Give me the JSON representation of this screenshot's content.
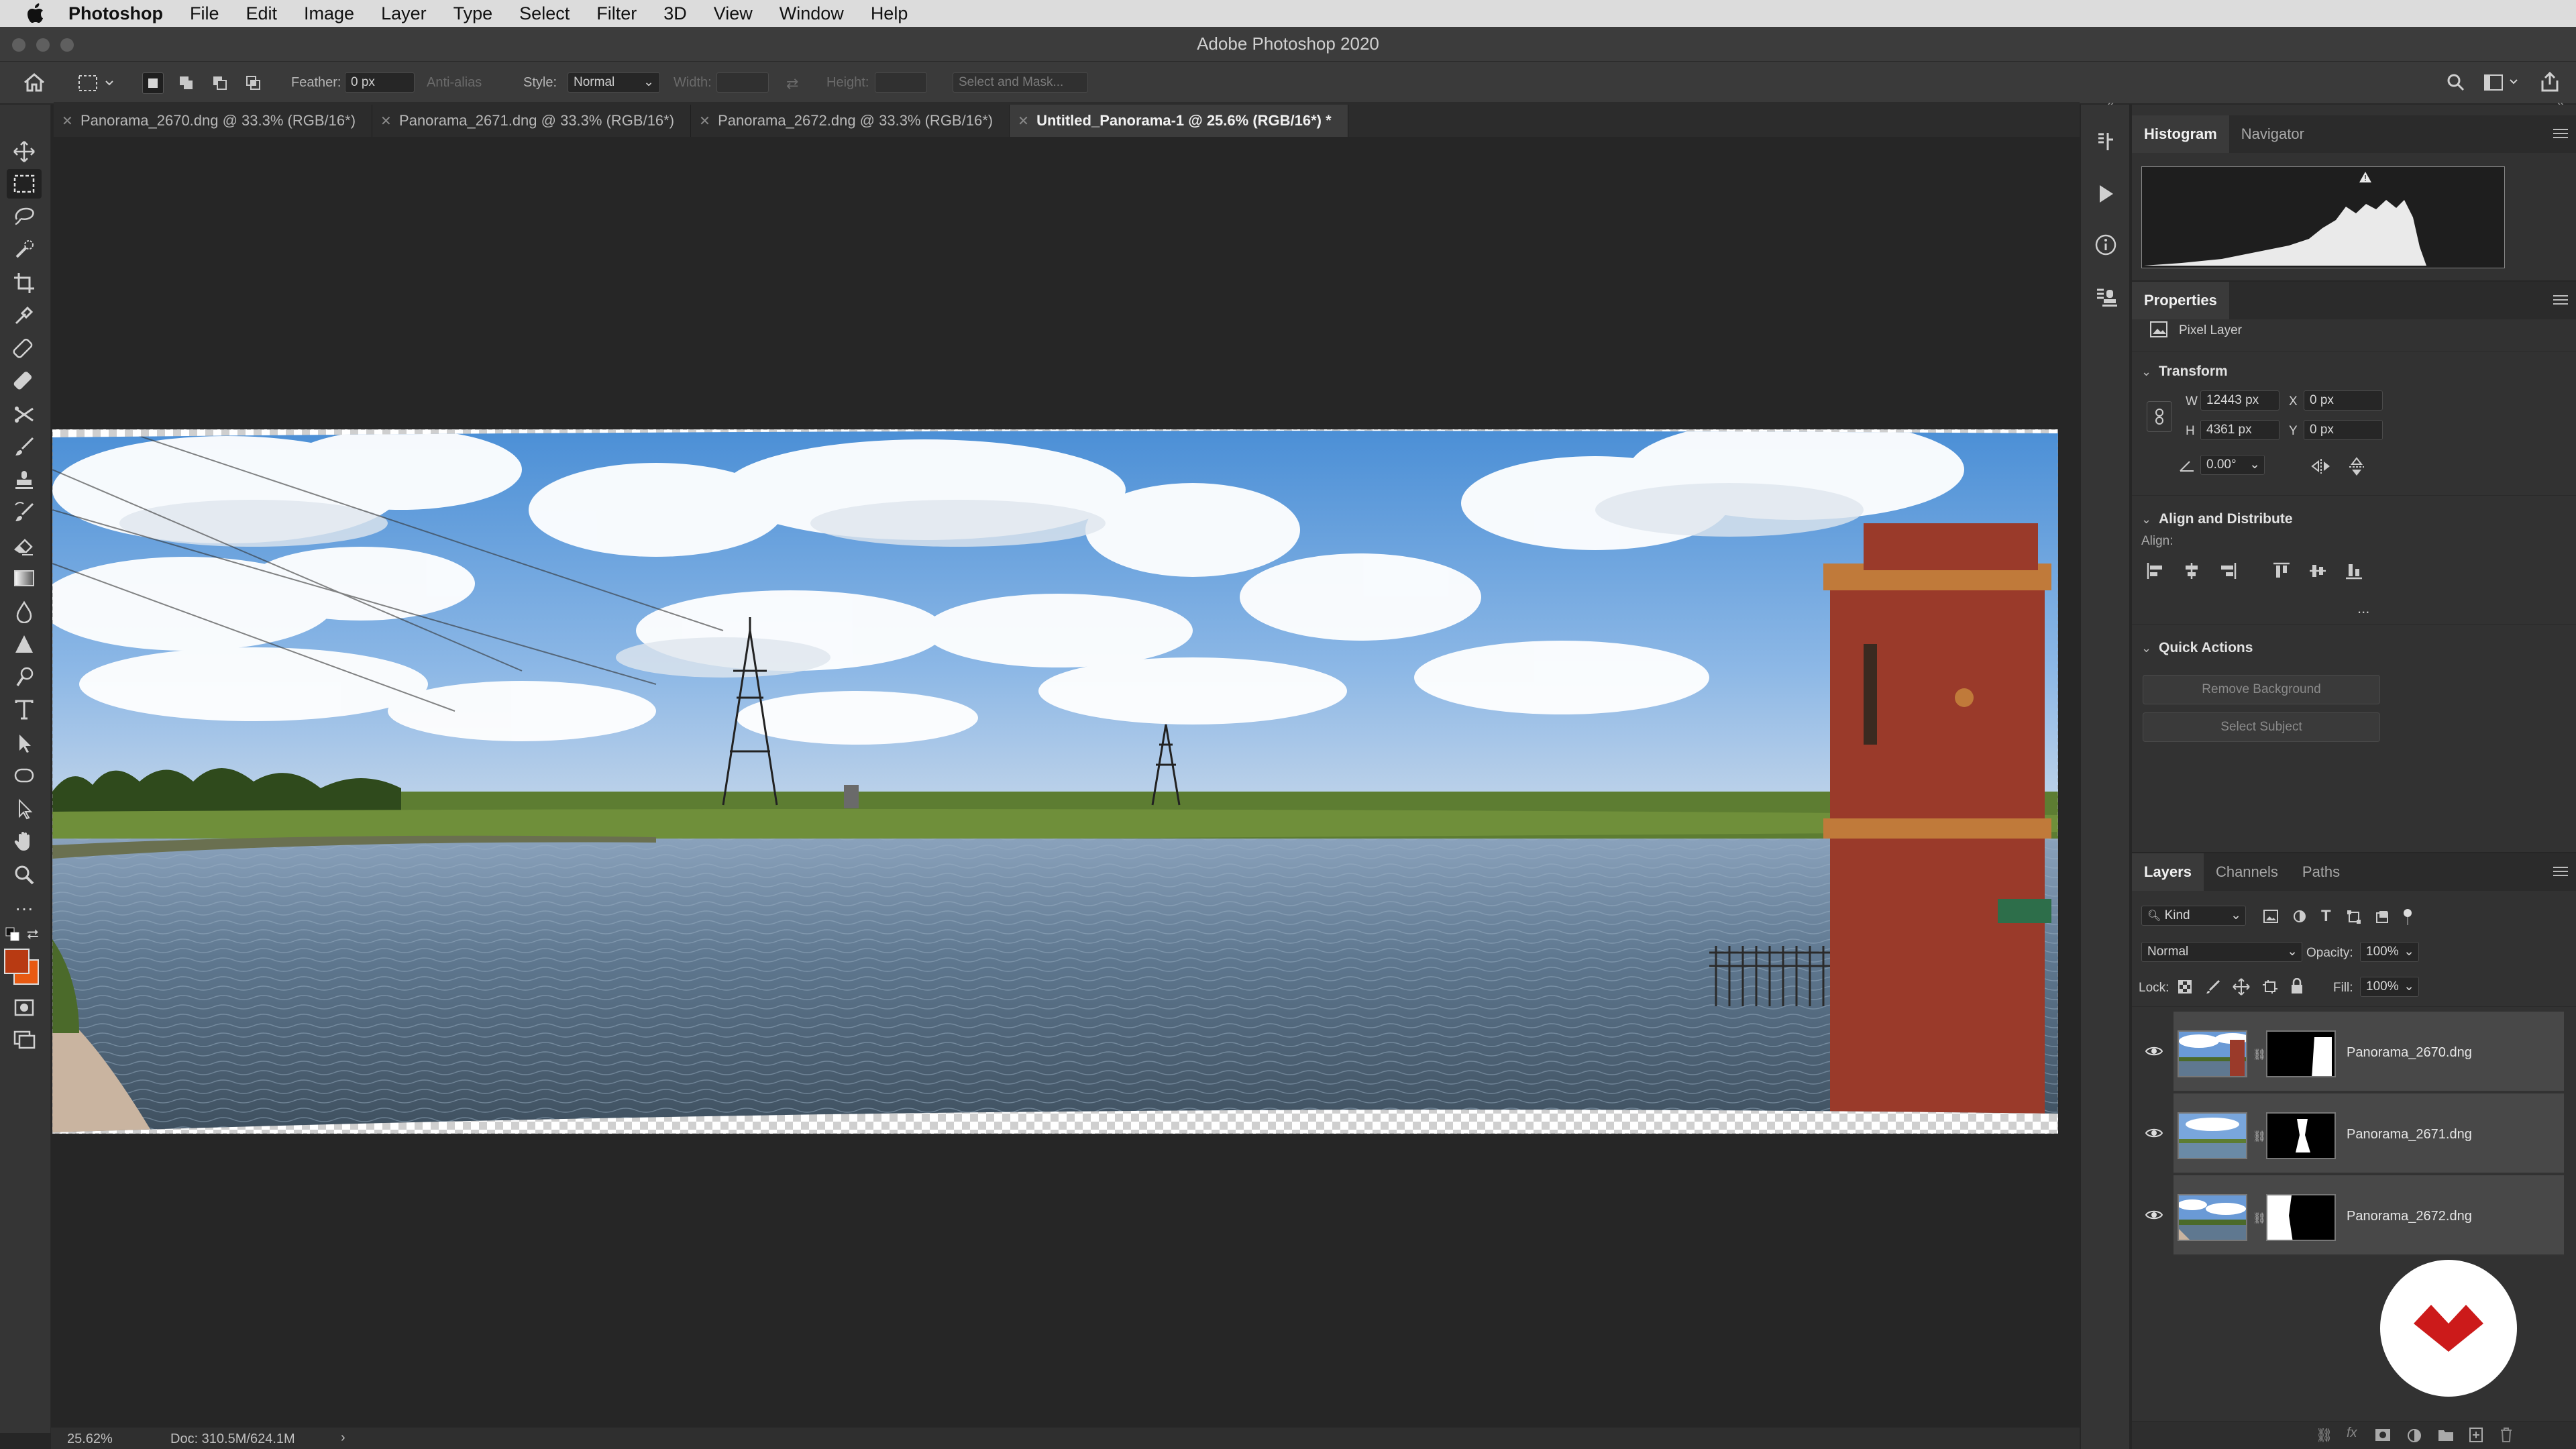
{
  "menubar": {
    "app_name": "Photoshop",
    "items": [
      "File",
      "Edit",
      "Image",
      "Layer",
      "Type",
      "Select",
      "Filter",
      "3D",
      "View",
      "Window",
      "Help"
    ]
  },
  "window": {
    "title": "Adobe Photoshop 2020"
  },
  "options": {
    "feather_label": "Feather:",
    "feather_value": "0 px",
    "antialias_label": "Anti-alias",
    "style_label": "Style:",
    "style_value": "Normal",
    "width_label": "Width:",
    "height_label": "Height:",
    "select_mask_label": "Select and Mask..."
  },
  "tabs": [
    {
      "label": "Panorama_2670.dng @ 33.3% (RGB/16*)",
      "active": false
    },
    {
      "label": "Panorama_2671.dng @ 33.3% (RGB/16*)",
      "active": false
    },
    {
      "label": "Panorama_2672.dng @ 33.3% (RGB/16*)",
      "active": false
    },
    {
      "label": "Untitled_Panorama-1 @ 25.6% (RGB/16*) *",
      "active": true
    }
  ],
  "status": {
    "zoom": "25.62%",
    "doc": "Doc: 310.5M/624.1M",
    "arrow": "›"
  },
  "histogram_panel": {
    "tab_histogram": "Histogram",
    "tab_navigator": "Navigator"
  },
  "properties": {
    "title": "Properties",
    "layer_type": "Pixel Layer",
    "transform_title": "Transform",
    "w_label": "W",
    "w_value": "12443 px",
    "h_label": "H",
    "h_value": "4361 px",
    "x_label": "X",
    "x_value": "0 px",
    "y_label": "Y",
    "y_value": "0 px",
    "angle_value": "0.00°",
    "align_title": "Align and Distribute",
    "align_label": "Align:",
    "more": "...",
    "quick_actions_title": "Quick Actions",
    "remove_bg": "Remove Background",
    "select_subject": "Select Subject"
  },
  "layers_panel": {
    "tab_layers": "Layers",
    "tab_channels": "Channels",
    "tab_paths": "Paths",
    "kind_value": "Kind",
    "blend_mode": "Normal",
    "opacity_label": "Opacity:",
    "opacity_value": "100%",
    "lock_label": "Lock:",
    "fill_label": "Fill:",
    "fill_value": "100%",
    "layers": [
      {
        "name": "Panorama_2670.dng",
        "visible": true
      },
      {
        "name": "Panorama_2671.dng",
        "visible": true
      },
      {
        "name": "Panorama_2672.dng",
        "visible": true
      }
    ]
  },
  "colors": {
    "foreground": "#b83a12",
    "background": "#e85a12",
    "logo": "#cc1a1a",
    "accent_panel": "#323232"
  },
  "icons": {
    "toolbar": [
      "move-icon",
      "marquee-icon",
      "lasso-icon",
      "quick-select-icon",
      "crop-icon",
      "eyedropper-icon",
      "spot-healing-icon",
      "healing-brush-icon",
      "patch-icon",
      "brush-icon",
      "clone-stamp-icon",
      "history-brush-icon",
      "eraser-icon",
      "gradient-icon",
      "blur-icon",
      "dodge-icon",
      "pen-icon",
      "type-icon",
      "path-select-icon",
      "shape-icon",
      "hand-icon",
      "zoom-icon",
      "more-tools-icon"
    ]
  }
}
